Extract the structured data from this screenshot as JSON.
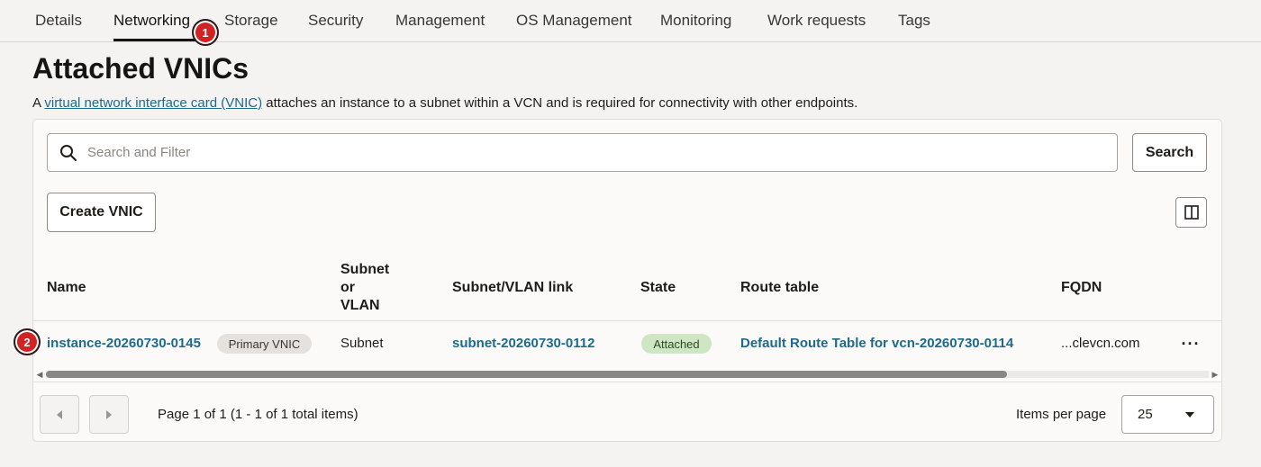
{
  "tabs": [
    {
      "label": "Details"
    },
    {
      "label": "Networking"
    },
    {
      "label": "Storage"
    },
    {
      "label": "Security"
    },
    {
      "label": "Management"
    },
    {
      "label": "OS Management"
    },
    {
      "label": "Monitoring"
    },
    {
      "label": "Work requests"
    },
    {
      "label": "Tags"
    }
  ],
  "markers": {
    "one": "1",
    "two": "2"
  },
  "page": {
    "title": "Attached VNICs",
    "desc_prefix": "A ",
    "desc_link": "virtual network interface card (VNIC)",
    "desc_suffix": " attaches an instance to a subnet within a VCN and is required for connectivity with other endpoints."
  },
  "search": {
    "placeholder": "Search and Filter",
    "button": "Search"
  },
  "toolbar": {
    "create_label": "Create VNIC"
  },
  "table": {
    "headers": {
      "name": "Name",
      "subnet_l1": "Subnet",
      "subnet_l2": "or",
      "subnet_l3": "VLAN",
      "link": "Subnet/VLAN link",
      "state": "State",
      "route": "Route table",
      "fqdn": "FQDN"
    },
    "rows": [
      {
        "name": "instance-20260730-0145",
        "badge": "Primary VNIC",
        "subnet_or_vlan": "Subnet",
        "link": "subnet-20260730-0112",
        "state": "Attached",
        "route": "Default Route Table for vcn-20260730-0114",
        "fqdn": "...clevcn.com",
        "actions": "···"
      }
    ]
  },
  "pagination": {
    "summary": "Page 1 of 1 (1 - 1 of 1 total items)",
    "items_per_page_label": "Items per page",
    "items_per_page_value": "25"
  },
  "colors": {
    "accent_link": "#1d6a8c",
    "marker": "#d32222",
    "attached_badge": "#cfe6c4"
  }
}
